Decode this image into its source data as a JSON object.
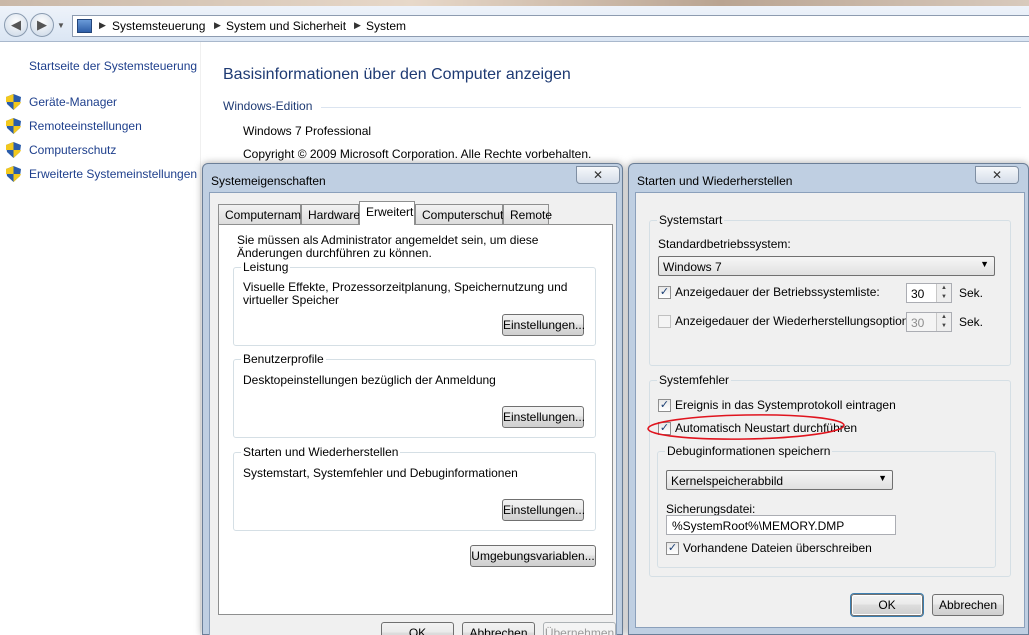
{
  "breadcrumb": [
    "Systemsteuerung",
    "System und Sicherheit",
    "System"
  ],
  "leftnav": {
    "home": "Startseite der Systemsteuerung",
    "items": [
      "Geräte-Manager",
      "Remoteeinstellungen",
      "Computerschutz",
      "Erweiterte Systemeinstellungen"
    ]
  },
  "main": {
    "title": "Basisinformationen über den Computer anzeigen",
    "edition_heading": "Windows-Edition",
    "edition_value": "Windows 7 Professional",
    "copyright": "Copyright © 2009 Microsoft Corporation. Alle Rechte vorbehalten."
  },
  "sysprops": {
    "title": "Systemeigenschaften",
    "close": "✕",
    "tabs": [
      "Computername",
      "Hardware",
      "Erweitert",
      "Computerschutz",
      "Remote"
    ],
    "admin_note": "Sie müssen als Administrator angemeldet sein, um diese Änderungen durchführen zu können.",
    "groups": [
      {
        "label": "Leistung",
        "desc": "Visuelle Effekte, Prozessorzeitplanung, Speichernutzung und virtueller Speicher",
        "button": "Einstellungen..."
      },
      {
        "label": "Benutzerprofile",
        "desc": "Desktopeinstellungen bezüglich der Anmeldung",
        "button": "Einstellungen..."
      },
      {
        "label": "Starten und Wiederherstellen",
        "desc": "Systemstart, Systemfehler und Debuginformationen",
        "button": "Einstellungen..."
      }
    ],
    "env_button": "Umgebungsvariablen...",
    "ok": "OK",
    "cancel": "Abbrechen",
    "apply": "Übernehmen"
  },
  "startup": {
    "title": "Starten und Wiederherstellen",
    "close": "✕",
    "systemstart_label": "Systemstart",
    "default_os_label": "Standardbetriebssystem:",
    "default_os_value": "Windows 7",
    "show_list_label": "Anzeigedauer der Betriebssystemliste:",
    "show_list_checked": true,
    "show_list_value": "30",
    "show_recovery_label": "Anzeigedauer der Wiederherstellungsoptionen:",
    "show_recovery_checked": false,
    "show_recovery_value": "30",
    "unit": "Sek.",
    "systemerror_label": "Systemfehler",
    "log_event_label": "Ereignis in das Systemprotokoll eintragen",
    "log_event_checked": true,
    "auto_restart_label": "Automatisch Neustart durchführen",
    "auto_restart_checked": true,
    "debug_label": "Debuginformationen speichern",
    "debug_value": "Kernelspeicherabbild",
    "dumpfile_label": "Sicherungsdatei:",
    "dumpfile_value": "%SystemRoot%\\MEMORY.DMP",
    "overwrite_label": "Vorhandene Dateien überschreiben",
    "overwrite_checked": true,
    "ok": "OK",
    "cancel": "Abbrechen"
  },
  "colors": {
    "link": "#1e3f8c",
    "heading": "#1e3a73",
    "highlight_circle": "#e0141e"
  },
  "icons": {
    "check": "✓",
    "dropdown": "▼",
    "back": "◀",
    "forward": "▶",
    "close": "✕"
  }
}
